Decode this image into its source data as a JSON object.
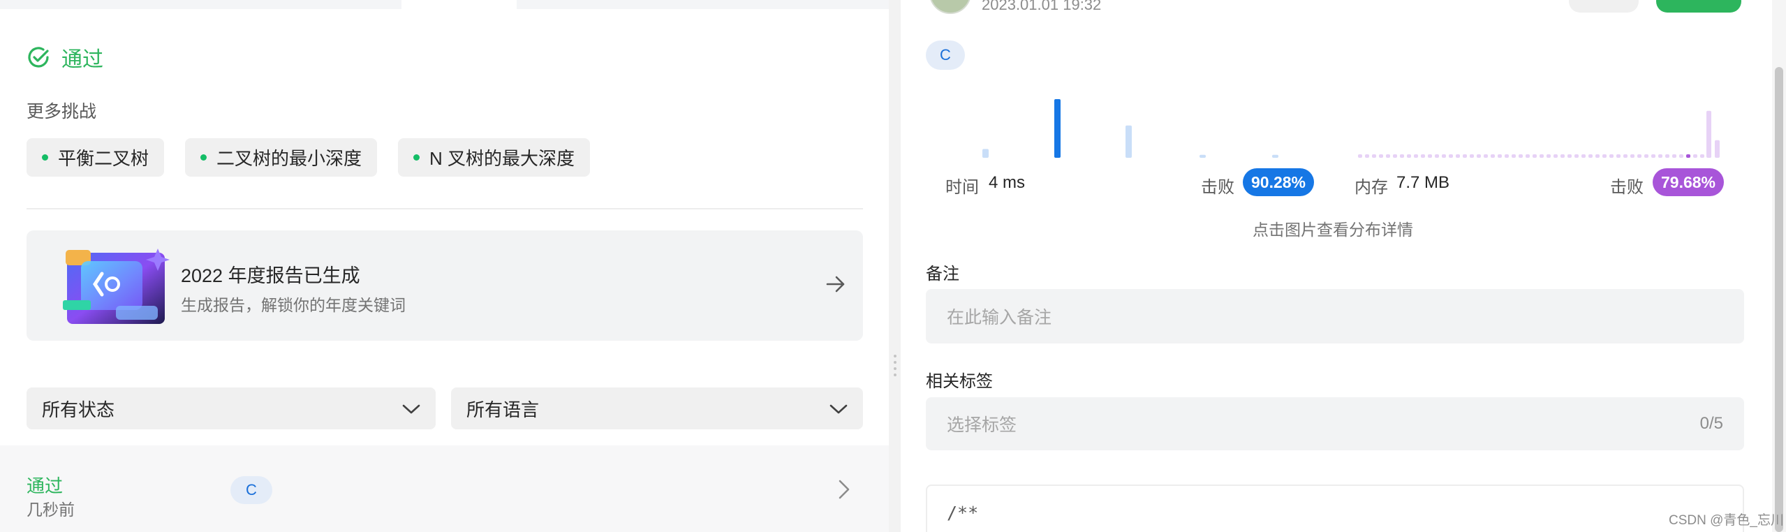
{
  "left": {
    "status": "通过",
    "more_challenges_label": "更多挑战",
    "related_problems": [
      "平衡二叉树",
      "二叉树的最小深度",
      "N 叉树的最大深度"
    ],
    "report": {
      "title": "2022 年度报告已生成",
      "subtitle": "生成报告，解锁你的年度关键词"
    },
    "filters": {
      "status": "所有状态",
      "language": "所有语言"
    },
    "submission": {
      "status": "通过",
      "time": "几秒前",
      "language": "C"
    }
  },
  "right": {
    "date_partial": "2023.01.01 19:32",
    "language": "C",
    "runtime": {
      "label": "时间",
      "value": "4 ms",
      "beat_label": "击败",
      "beat_value": "90.28%"
    },
    "memory": {
      "label": "内存",
      "value": "7.7 MB",
      "beat_label": "击败",
      "beat_value": "79.68%"
    },
    "chart_hint": "点击图片查看分布详情",
    "notes": {
      "label": "备注",
      "placeholder": "在此输入备注"
    },
    "tags": {
      "label": "相关标签",
      "placeholder": "选择标签",
      "count": "0/5"
    },
    "code_preview": "/**"
  },
  "colors": {
    "accepted": "#2db55d",
    "runtime_accent": "#1677e5",
    "memory_accent": "#a855d9"
  },
  "runtime_distribution": [
    0.15,
    1.0,
    0.55,
    0.05,
    0.05
  ],
  "memory_distribution_highlight": 0.06,
  "memory_distribution_right": [
    0.8,
    0.3
  ],
  "watermark": "CSDN @青色_忘川"
}
